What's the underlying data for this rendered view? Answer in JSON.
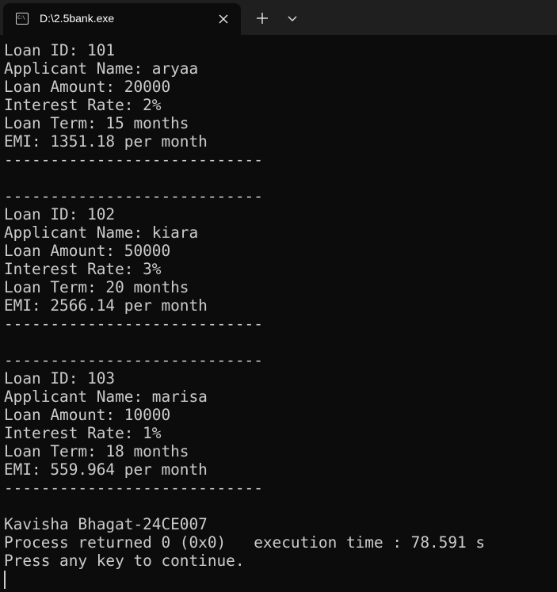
{
  "window": {
    "tab_title": "D:\\2.5bank.exe",
    "icon_text": "C:\\",
    "new_tab_symbol": "+",
    "colors": {
      "background": "#0c0c0c",
      "tabbar": "#1f1f1f",
      "text": "#cccccc"
    }
  },
  "console": {
    "lines": [
      "Loan ID: 101",
      "Applicant Name: aryaa",
      "Loan Amount: 20000",
      "Interest Rate: 2%",
      "Loan Term: 15 months",
      "EMI: 1351.18 per month",
      "----------------------------",
      "",
      "----------------------------",
      "Loan ID: 102",
      "Applicant Name: kiara",
      "Loan Amount: 50000",
      "Interest Rate: 3%",
      "Loan Term: 20 months",
      "EMI: 2566.14 per month",
      "----------------------------",
      "",
      "----------------------------",
      "Loan ID: 103",
      "Applicant Name: marisa",
      "Loan Amount: 10000",
      "Interest Rate: 1%",
      "Loan Term: 18 months",
      "EMI: 559.964 per month",
      "----------------------------",
      "",
      "Kavisha Bhagat-24CE007",
      "Process returned 0 (0x0)   execution time : 78.591 s",
      "Press any key to continue."
    ]
  }
}
